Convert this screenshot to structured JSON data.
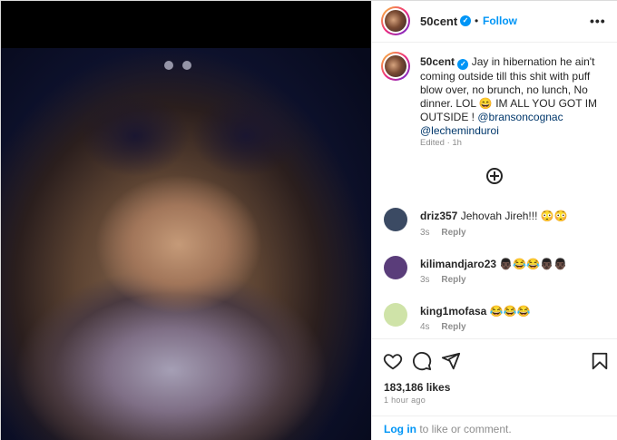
{
  "post": {
    "username": "50cent",
    "verified_mark": "✓",
    "dot": "•",
    "follow_label": "Follow",
    "more_label": "•••",
    "caption_text": "Jay in hibernation he ain't coming outside till this shit with puff blow over, no brunch, no lunch, No dinner. LOL 😄 IM ALL YOU GOT IM OUTSIDE !",
    "caption_mentions": "@bransoncognac @lecheminduroi",
    "edited_label": "Edited · 1h",
    "image_alt": "close-up face photo"
  },
  "comments": [
    {
      "user": "driz357",
      "text": "Jehovah Jireh!!! 😳😳",
      "age": "3s",
      "reply": "Reply",
      "avatar_color": "#3b4a63"
    },
    {
      "user": "kilimandjaro23",
      "text": "👨🏿😂😂👨🏿👨🏿",
      "age": "3s",
      "reply": "Reply",
      "avatar_color": "#5a3d7a"
    },
    {
      "user": "king1mofasa",
      "text": "😂😂😂",
      "age": "4s",
      "reply": "Reply",
      "avatar_color": "#cfe3a8"
    }
  ],
  "actions": {
    "likes": "183,186 likes",
    "time": "1 hour ago"
  },
  "login": {
    "link": "Log in",
    "rest": " to like or comment."
  },
  "icons": [
    "heart-icon",
    "comment-icon",
    "share-icon",
    "bookmark-icon",
    "plus-circle-icon",
    "more-icon"
  ]
}
